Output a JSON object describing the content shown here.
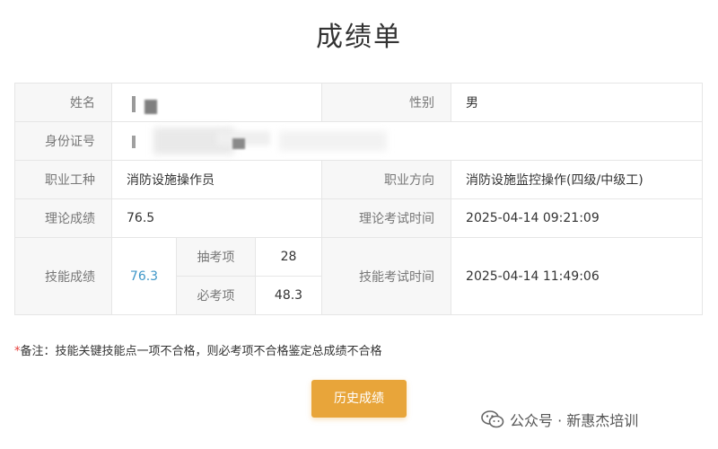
{
  "page": {
    "title": "成绩单"
  },
  "table": {
    "name_label": "姓名",
    "gender_label": "性别",
    "gender_value": "男",
    "id_label": "身份证号",
    "occupation_label": "职业工种",
    "occupation_value": "消防设施操作员",
    "direction_label": "职业方向",
    "direction_value": "消防设施监控操作(四级/中级工)",
    "theory_score_label": "理论成绩",
    "theory_score_value": "76.5",
    "theory_time_label": "理论考试时间",
    "theory_time_value": "2025-04-14 09:21:09",
    "skill_score_label": "技能成绩",
    "skill_score_value": "76.3",
    "random_item_label": "抽考项",
    "random_item_value": "28",
    "required_item_label": "必考项",
    "required_item_value": "48.3",
    "skill_time_label": "技能考试时间",
    "skill_time_value": "2025-04-14 11:49:06"
  },
  "note": {
    "star": "*",
    "text": "备注：技能关键技能点一项不合格，则必考项不合格鉴定总成绩不合格"
  },
  "button": {
    "history_label": "历史成绩"
  },
  "watermark": {
    "text": "公众号 · 新惠杰培训",
    "icon": "wechat-icon"
  },
  "colors": {
    "accent_button": "#e8a53a",
    "skill_score_blue": "#3f97c8",
    "label_bg": "#f7f7f7",
    "border": "#e6e6e6"
  }
}
